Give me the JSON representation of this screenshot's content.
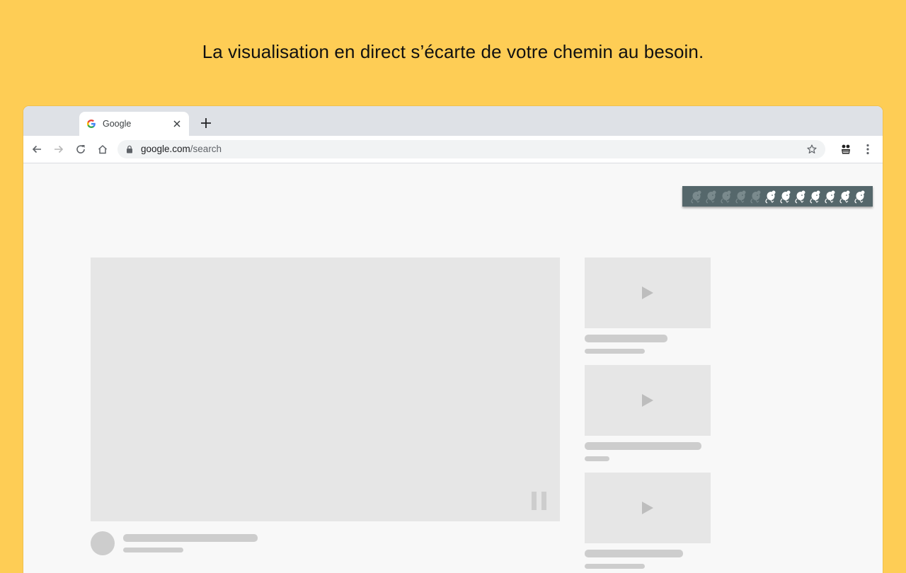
{
  "headline": "La visualisation en direct s’écarte de votre chemin au besoin.",
  "browser": {
    "tab_title": "Google",
    "url_host": "google.com",
    "url_path": "/search"
  },
  "icons": [
    "google-g-icon",
    "close-icon",
    "plus-icon",
    "back-arrow-icon",
    "forward-arrow-icon",
    "reload-icon",
    "home-icon",
    "lock-icon",
    "star-icon",
    "extension-icon",
    "more-vert-icon",
    "play-icon",
    "pause-icon",
    "mouse-icon"
  ],
  "colors": {
    "background": "#FECD55",
    "overlay": "#55676B",
    "placeholder": "#E6E6E6",
    "placeholder_line": "#CDCDCD"
  },
  "live_view": {
    "total_mice": 12,
    "dimmed_mice": 5
  }
}
